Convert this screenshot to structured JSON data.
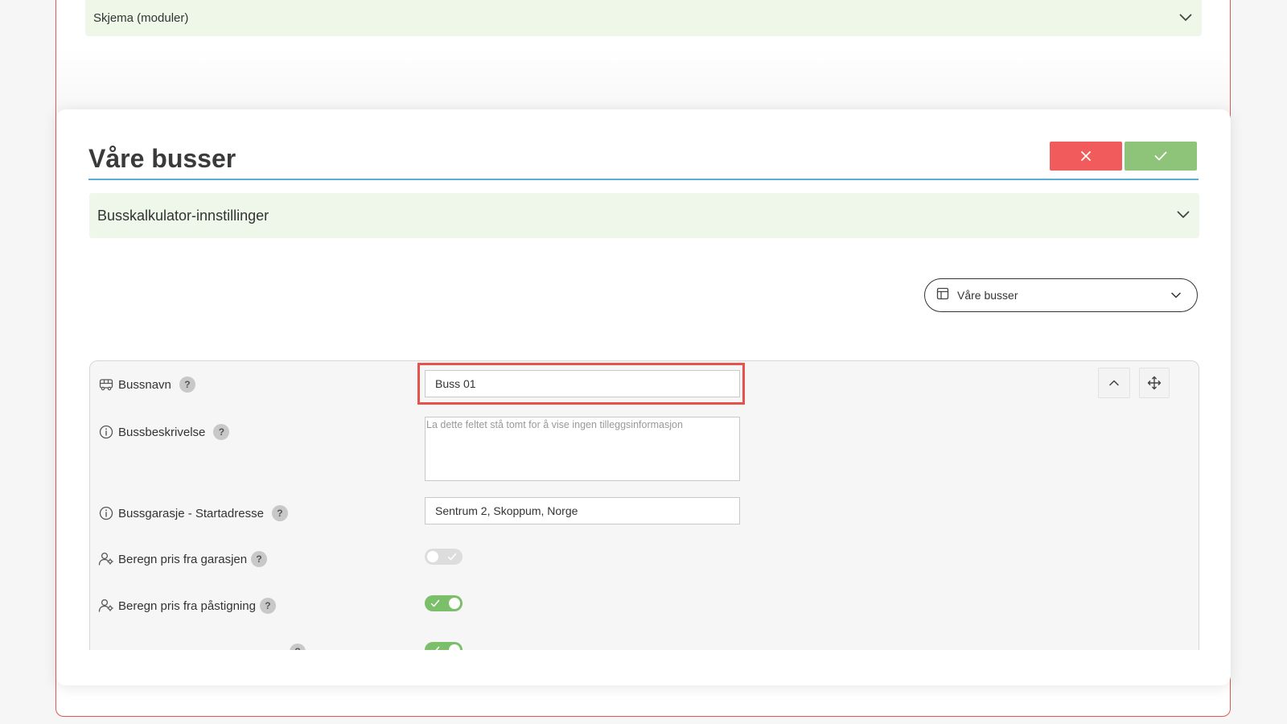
{
  "background": {
    "section_label": "Skjema (moduler)"
  },
  "modal": {
    "title": "Våre busser",
    "accordion_label": "Busskalkulator-innstillinger",
    "table_select": "Våre busser"
  },
  "form": {
    "bus_name": {
      "label": "Bussnavn",
      "value": "Buss 01"
    },
    "bus_description": {
      "label": "Bussbeskrivelse",
      "placeholder": "La dette feltet stå tomt for å vise ingen tilleggsinformasjon"
    },
    "garage": {
      "label": "Bussgarasje - Startadresse",
      "value": "Sentrum 2, Skoppum, Norge"
    },
    "price_from_garage": {
      "label": "Beregn pris fra garasjen",
      "enabled": false
    },
    "price_from_boarding": {
      "label": "Beregn pris fra påstigning",
      "enabled": true
    },
    "third_toggle": {
      "enabled": true
    },
    "help_glyph": "?"
  },
  "colors": {
    "cancel": "#f25b5b",
    "confirm": "#8dc47a",
    "accent_line": "#5aaed3",
    "highlight": "#e5534b",
    "section_bg": "#eef7e9"
  }
}
